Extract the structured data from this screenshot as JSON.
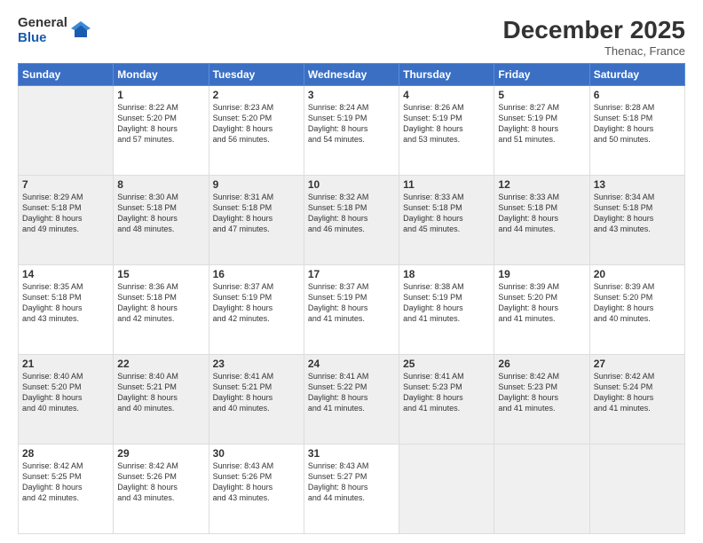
{
  "logo": {
    "general": "General",
    "blue": "Blue"
  },
  "header": {
    "month": "December 2025",
    "location": "Thenac, France"
  },
  "days_of_week": [
    "Sunday",
    "Monday",
    "Tuesday",
    "Wednesday",
    "Thursday",
    "Friday",
    "Saturday"
  ],
  "weeks": [
    [
      {
        "num": "",
        "info": ""
      },
      {
        "num": "1",
        "info": "Sunrise: 8:22 AM\nSunset: 5:20 PM\nDaylight: 8 hours\nand 57 minutes."
      },
      {
        "num": "2",
        "info": "Sunrise: 8:23 AM\nSunset: 5:20 PM\nDaylight: 8 hours\nand 56 minutes."
      },
      {
        "num": "3",
        "info": "Sunrise: 8:24 AM\nSunset: 5:19 PM\nDaylight: 8 hours\nand 54 minutes."
      },
      {
        "num": "4",
        "info": "Sunrise: 8:26 AM\nSunset: 5:19 PM\nDaylight: 8 hours\nand 53 minutes."
      },
      {
        "num": "5",
        "info": "Sunrise: 8:27 AM\nSunset: 5:19 PM\nDaylight: 8 hours\nand 51 minutes."
      },
      {
        "num": "6",
        "info": "Sunrise: 8:28 AM\nSunset: 5:18 PM\nDaylight: 8 hours\nand 50 minutes."
      }
    ],
    [
      {
        "num": "7",
        "info": "Sunrise: 8:29 AM\nSunset: 5:18 PM\nDaylight: 8 hours\nand 49 minutes."
      },
      {
        "num": "8",
        "info": "Sunrise: 8:30 AM\nSunset: 5:18 PM\nDaylight: 8 hours\nand 48 minutes."
      },
      {
        "num": "9",
        "info": "Sunrise: 8:31 AM\nSunset: 5:18 PM\nDaylight: 8 hours\nand 47 minutes."
      },
      {
        "num": "10",
        "info": "Sunrise: 8:32 AM\nSunset: 5:18 PM\nDaylight: 8 hours\nand 46 minutes."
      },
      {
        "num": "11",
        "info": "Sunrise: 8:33 AM\nSunset: 5:18 PM\nDaylight: 8 hours\nand 45 minutes."
      },
      {
        "num": "12",
        "info": "Sunrise: 8:33 AM\nSunset: 5:18 PM\nDaylight: 8 hours\nand 44 minutes."
      },
      {
        "num": "13",
        "info": "Sunrise: 8:34 AM\nSunset: 5:18 PM\nDaylight: 8 hours\nand 43 minutes."
      }
    ],
    [
      {
        "num": "14",
        "info": "Sunrise: 8:35 AM\nSunset: 5:18 PM\nDaylight: 8 hours\nand 43 minutes."
      },
      {
        "num": "15",
        "info": "Sunrise: 8:36 AM\nSunset: 5:18 PM\nDaylight: 8 hours\nand 42 minutes."
      },
      {
        "num": "16",
        "info": "Sunrise: 8:37 AM\nSunset: 5:19 PM\nDaylight: 8 hours\nand 42 minutes."
      },
      {
        "num": "17",
        "info": "Sunrise: 8:37 AM\nSunset: 5:19 PM\nDaylight: 8 hours\nand 41 minutes."
      },
      {
        "num": "18",
        "info": "Sunrise: 8:38 AM\nSunset: 5:19 PM\nDaylight: 8 hours\nand 41 minutes."
      },
      {
        "num": "19",
        "info": "Sunrise: 8:39 AM\nSunset: 5:20 PM\nDaylight: 8 hours\nand 41 minutes."
      },
      {
        "num": "20",
        "info": "Sunrise: 8:39 AM\nSunset: 5:20 PM\nDaylight: 8 hours\nand 40 minutes."
      }
    ],
    [
      {
        "num": "21",
        "info": "Sunrise: 8:40 AM\nSunset: 5:20 PM\nDaylight: 8 hours\nand 40 minutes."
      },
      {
        "num": "22",
        "info": "Sunrise: 8:40 AM\nSunset: 5:21 PM\nDaylight: 8 hours\nand 40 minutes."
      },
      {
        "num": "23",
        "info": "Sunrise: 8:41 AM\nSunset: 5:21 PM\nDaylight: 8 hours\nand 40 minutes."
      },
      {
        "num": "24",
        "info": "Sunrise: 8:41 AM\nSunset: 5:22 PM\nDaylight: 8 hours\nand 41 minutes."
      },
      {
        "num": "25",
        "info": "Sunrise: 8:41 AM\nSunset: 5:23 PM\nDaylight: 8 hours\nand 41 minutes."
      },
      {
        "num": "26",
        "info": "Sunrise: 8:42 AM\nSunset: 5:23 PM\nDaylight: 8 hours\nand 41 minutes."
      },
      {
        "num": "27",
        "info": "Sunrise: 8:42 AM\nSunset: 5:24 PM\nDaylight: 8 hours\nand 41 minutes."
      }
    ],
    [
      {
        "num": "28",
        "info": "Sunrise: 8:42 AM\nSunset: 5:25 PM\nDaylight: 8 hours\nand 42 minutes."
      },
      {
        "num": "29",
        "info": "Sunrise: 8:42 AM\nSunset: 5:26 PM\nDaylight: 8 hours\nand 43 minutes."
      },
      {
        "num": "30",
        "info": "Sunrise: 8:43 AM\nSunset: 5:26 PM\nDaylight: 8 hours\nand 43 minutes."
      },
      {
        "num": "31",
        "info": "Sunrise: 8:43 AM\nSunset: 5:27 PM\nDaylight: 8 hours\nand 44 minutes."
      },
      {
        "num": "",
        "info": ""
      },
      {
        "num": "",
        "info": ""
      },
      {
        "num": "",
        "info": ""
      }
    ]
  ]
}
